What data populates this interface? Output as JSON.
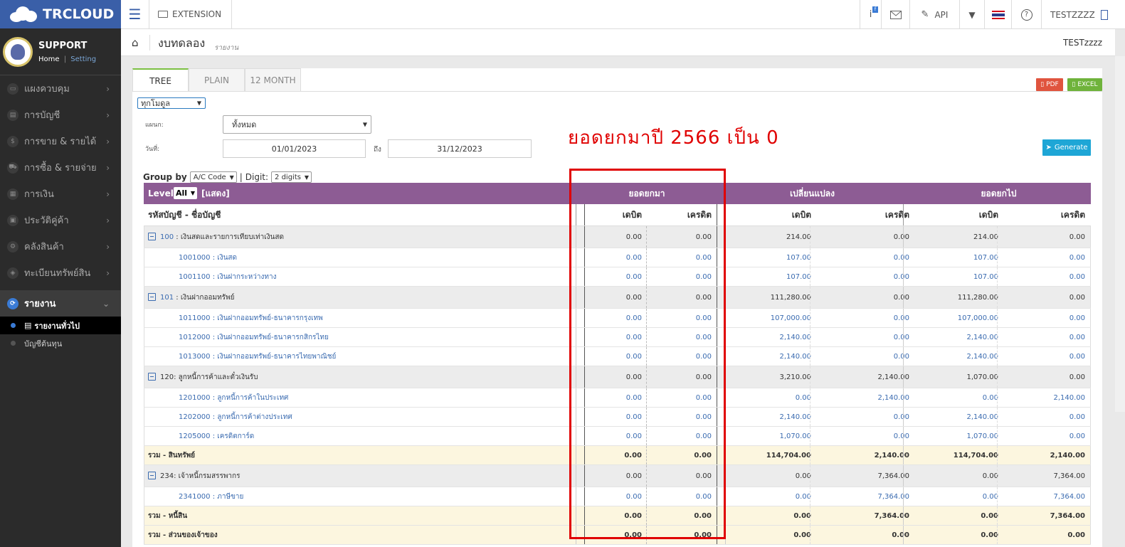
{
  "app": {
    "logo_text": "TRCLOUD"
  },
  "profile": {
    "name": "SUPPORT",
    "home": "Home",
    "sep": "|",
    "setting": "Setting"
  },
  "sidebar": {
    "items": [
      {
        "label": "แผงควบคุม",
        "icon": "▭"
      },
      {
        "label": "การบัญชี",
        "icon": "▤"
      },
      {
        "label": "การขาย & รายได้",
        "icon": "$"
      },
      {
        "label": "การซื้อ & รายจ่าย",
        "icon": "⛟"
      },
      {
        "label": "การเงิน",
        "icon": "▦"
      },
      {
        "label": "ประวัติคู่ค้า",
        "icon": "▣"
      },
      {
        "label": "คลังสินค้า",
        "icon": "⚙"
      },
      {
        "label": "ทะเบียนทรัพย์สิน",
        "icon": "◈"
      }
    ],
    "active": {
      "label": "รายงาน",
      "icon": "⟳"
    },
    "subs": [
      {
        "label": "รายงานทั่วไป"
      },
      {
        "label": "บัญชีต้นทุน"
      }
    ]
  },
  "topbar": {
    "extension": "EXTENSION",
    "info_badge": "f",
    "api": "API",
    "user": "TESTZZZZ"
  },
  "header": {
    "title": "งบทดลอง",
    "subtitle": "รายงาน",
    "user": "TESTzzzz"
  },
  "tabs": [
    {
      "label": "TREE"
    },
    {
      "label": "PLAIN"
    },
    {
      "label": "12 MONTH"
    }
  ],
  "export": {
    "pdf": "PDF",
    "excel": "EXCEL"
  },
  "filters": {
    "module": "ทุกโมดูล",
    "dept_label": "แผนก:",
    "dept": "ทั้งหมด",
    "date_label": "วันที่:",
    "date_from": "01/01/2023",
    "to_label": "ถึง",
    "date_to": "31/12/2023",
    "generate": "Generate",
    "group_by_label": "Group by",
    "group_by": "A/C Code",
    "bar": "|",
    "digit_label": "Digit:",
    "digit": "2 digits"
  },
  "annotation": "ยอดยกมาปี 2566 เป็น 0",
  "table": {
    "level_label": "Level:",
    "level_value": "All",
    "show_label": "[แสดง]",
    "groups": [
      "ยอดยกมา",
      "เปลี่ยนแปลง",
      "ยอดยกไป"
    ],
    "account_header": "รหัสบัญชี - ชื่อบัญชี",
    "debit": "เดบิต",
    "credit": "เครดิต",
    "rows": [
      {
        "type": "grp",
        "code": "100",
        "name": " : เงินสดและรายการเทียบเท่าเงินสด",
        "v": [
          "0.00",
          "0.00",
          "214.00",
          "0.00",
          "214.00",
          "0.00"
        ]
      },
      {
        "type": "acc",
        "code": "1001000",
        "name": " : เงินสด",
        "v": [
          "0.00",
          "0.00",
          "107.00",
          "0.00",
          "107.00",
          "0.00"
        ]
      },
      {
        "type": "acc",
        "code": "1001100",
        "name": " : เงินฝากระหว่างทาง",
        "v": [
          "0.00",
          "0.00",
          "107.00",
          "0.00",
          "107.00",
          "0.00"
        ]
      },
      {
        "type": "grp",
        "code": "101",
        "name": " : เงินฝากออมทรัพย์",
        "v": [
          "0.00",
          "0.00",
          "111,280.00",
          "0.00",
          "111,280.00",
          "0.00"
        ]
      },
      {
        "type": "acc",
        "code": "1011000",
        "name": " : เงินฝากออมทรัพย์-ธนาคารกรุงเทพ",
        "v": [
          "0.00",
          "0.00",
          "107,000.00",
          "0.00",
          "107,000.00",
          "0.00"
        ]
      },
      {
        "type": "acc",
        "code": "1012000",
        "name": " : เงินฝากออมทรัพย์-ธนาคารกสิกรไทย",
        "v": [
          "0.00",
          "0.00",
          "2,140.00",
          "0.00",
          "2,140.00",
          "0.00"
        ]
      },
      {
        "type": "acc",
        "code": "1013000",
        "name": " : เงินฝากออมทรัพย์-ธนาคารไทยพาณิชย์",
        "v": [
          "0.00",
          "0.00",
          "2,140.00",
          "0.00",
          "2,140.00",
          "0.00"
        ]
      },
      {
        "type": "grp",
        "code": "",
        "name": "120: ลูกหนี้การค้าและตั๋วเงินรับ",
        "v": [
          "0.00",
          "0.00",
          "3,210.00",
          "2,140.00",
          "1,070.00",
          "0.00"
        ]
      },
      {
        "type": "acc",
        "code": "1201000",
        "name": " : ลูกหนี้การค้าในประเทศ",
        "v": [
          "0.00",
          "0.00",
          "0.00",
          "2,140.00",
          "0.00",
          "2,140.00"
        ]
      },
      {
        "type": "acc",
        "code": "1202000",
        "name": " : ลูกหนี้การค้าต่างประเทศ",
        "v": [
          "0.00",
          "0.00",
          "2,140.00",
          "0.00",
          "2,140.00",
          "0.00"
        ]
      },
      {
        "type": "acc",
        "code": "1205000",
        "name": " : เครดิตการ์ด",
        "v": [
          "0.00",
          "0.00",
          "1,070.00",
          "0.00",
          "1,070.00",
          "0.00"
        ]
      },
      {
        "type": "tot",
        "code": "",
        "name": "รวม - สินทรัพย์",
        "v": [
          "0.00",
          "0.00",
          "114,704.00",
          "2,140.00",
          "114,704.00",
          "2,140.00"
        ]
      },
      {
        "type": "grp",
        "code": "",
        "name": "234: เจ้าหนี้กรมสรรพากร",
        "v": [
          "0.00",
          "0.00",
          "0.00",
          "7,364.00",
          "0.00",
          "7,364.00"
        ]
      },
      {
        "type": "acc",
        "code": "2341000",
        "name": " : ภาษีขาย",
        "v": [
          "0.00",
          "0.00",
          "0.00",
          "7,364.00",
          "0.00",
          "7,364.00"
        ]
      },
      {
        "type": "tot",
        "code": "",
        "name": "รวม - หนี้สิน",
        "v": [
          "0.00",
          "0.00",
          "0.00",
          "7,364.00",
          "0.00",
          "7,364.00"
        ]
      },
      {
        "type": "tot",
        "code": "",
        "name": "รวม - ส่วนของเจ้าของ",
        "v": [
          "0.00",
          "0.00",
          "0.00",
          "0.00",
          "0.00",
          "0.00"
        ]
      }
    ]
  },
  "colors": {
    "brand": "#3a5fa8",
    "table_header": "#8d5c94",
    "annotation": "#e00000",
    "generate": "#1ea6d6"
  }
}
